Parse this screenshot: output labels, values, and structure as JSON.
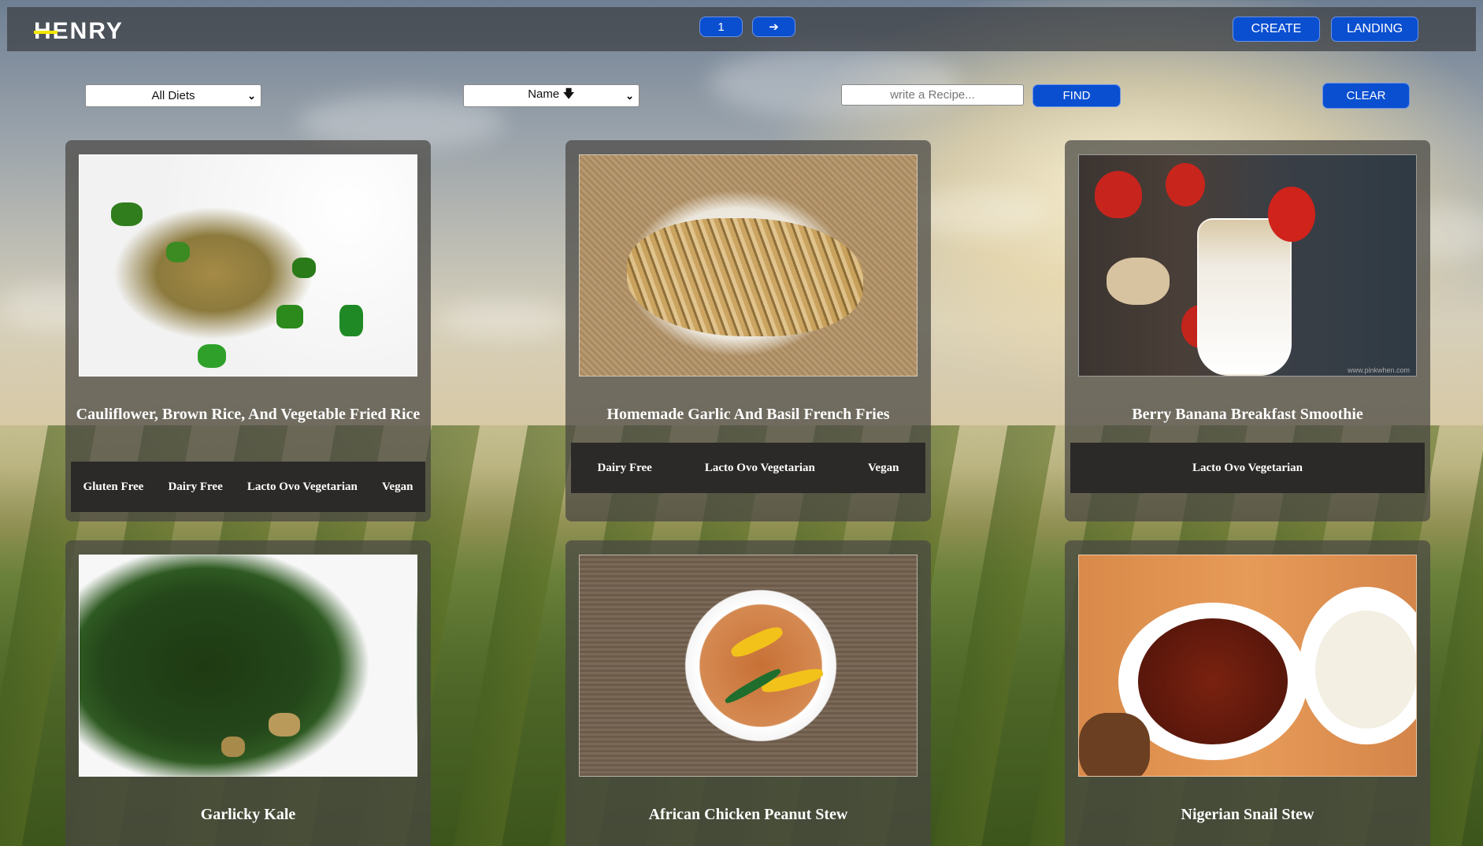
{
  "app": {
    "logo": "HENRY"
  },
  "pagination": {
    "current_page": "1",
    "next_arrow": "➔"
  },
  "nav": {
    "create_label": "CREATE",
    "landing_label": "LANDING"
  },
  "filters": {
    "diet_selected": "All Diets",
    "sort_selected": "Name 🡇",
    "search_placeholder": "write a Recipe...",
    "find_label": "FIND",
    "clear_label": "CLEAR"
  },
  "recipes": [
    {
      "title": "Cauliflower, Brown Rice, And Vegetable Fried Rice",
      "diets": [
        "Gluten Free",
        "Dairy Free",
        "Lacto Ovo Vegetarian",
        "Vegan"
      ],
      "image": "fried-rice-photo"
    },
    {
      "title": "Homemade Garlic And Basil French Fries",
      "diets": [
        "Dairy Free",
        "Lacto Ovo Vegetarian",
        "Vegan"
      ],
      "image": "french-fries-photo"
    },
    {
      "title": "Berry Banana Breakfast Smoothie",
      "diets": [
        "Lacto Ovo Vegetarian"
      ],
      "image": "smoothie-photo"
    },
    {
      "title": "Garlicky Kale",
      "diets": [],
      "image": "kale-photo"
    },
    {
      "title": "African Chicken Peanut Stew",
      "diets": [],
      "image": "peanut-stew-photo"
    },
    {
      "title": "Nigerian Snail Stew",
      "diets": [],
      "image": "snail-stew-photo"
    }
  ],
  "photo_watermark": "www.pinkwhen.com"
}
